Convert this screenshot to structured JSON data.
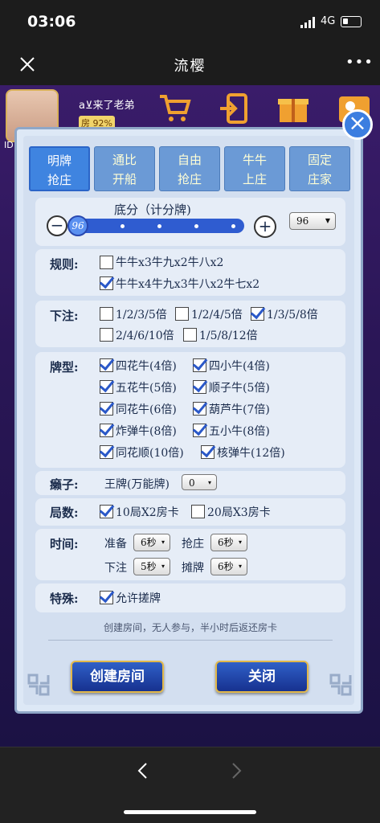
{
  "status": {
    "time": "03:06",
    "network": "4G"
  },
  "nav": {
    "title": "流樱"
  },
  "player": {
    "name": "a⊻来了老弟",
    "room_badge": "房",
    "room_count": "92%",
    "id_label": "ID:"
  },
  "tabs": [
    {
      "line1": "明牌",
      "line2": "抢庄"
    },
    {
      "line1": "通比",
      "line2": "开船"
    },
    {
      "line1": "自由",
      "line2": "抢庄"
    },
    {
      "line1": "牛牛",
      "line2": "上庄"
    },
    {
      "line1": "固定",
      "line2": "庄家"
    }
  ],
  "base_score": {
    "label": "底分（计分牌)",
    "value": "96",
    "slider_level": 0.04,
    "select_value": "96"
  },
  "rules": {
    "label": "规则:",
    "opt1": "牛牛x3牛九x2牛八x2",
    "opt2": "牛牛x4牛九x3牛八x2牛七x2"
  },
  "bet": {
    "label": "下注:",
    "o1": "1/2/3/5倍",
    "o2": "1/2/4/5倍",
    "o3": "1/3/5/8倍",
    "o4": "2/4/6/10倍",
    "o5": "1/5/8/12倍"
  },
  "cardtypes": {
    "label": "牌型:",
    "c1": "四花牛(4倍)",
    "c2": "四小牛(4倍)",
    "c3": "五花牛(5倍)",
    "c4": "顺子牛(5倍)",
    "c5": "同花牛(6倍)",
    "c6": "葫芦牛(7倍)",
    "c7": "炸弹牛(8倍)",
    "c8": "五小牛(8倍)",
    "c9": "同花顺(10倍)",
    "c10": "核弹牛(12倍)"
  },
  "wild": {
    "label": "癞子:",
    "text": "王牌(万能牌)",
    "value": "0"
  },
  "rounds": {
    "label": "局数:",
    "o1": "10局X2房卡",
    "o2": "20局X3房卡"
  },
  "timing": {
    "label": "时间:",
    "ready": "准备",
    "ready_v": "6秒",
    "grab": "抢庄",
    "grab_v": "6秒",
    "bet": "下注",
    "bet_v": "5秒",
    "show": "摊牌",
    "show_v": "6秒"
  },
  "special": {
    "label": "特殊:",
    "opt": "允许搓牌"
  },
  "notice": "创建房间，无人参与，半小时后返还房卡",
  "buttons": {
    "create": "创建房间",
    "close": "关闭"
  }
}
